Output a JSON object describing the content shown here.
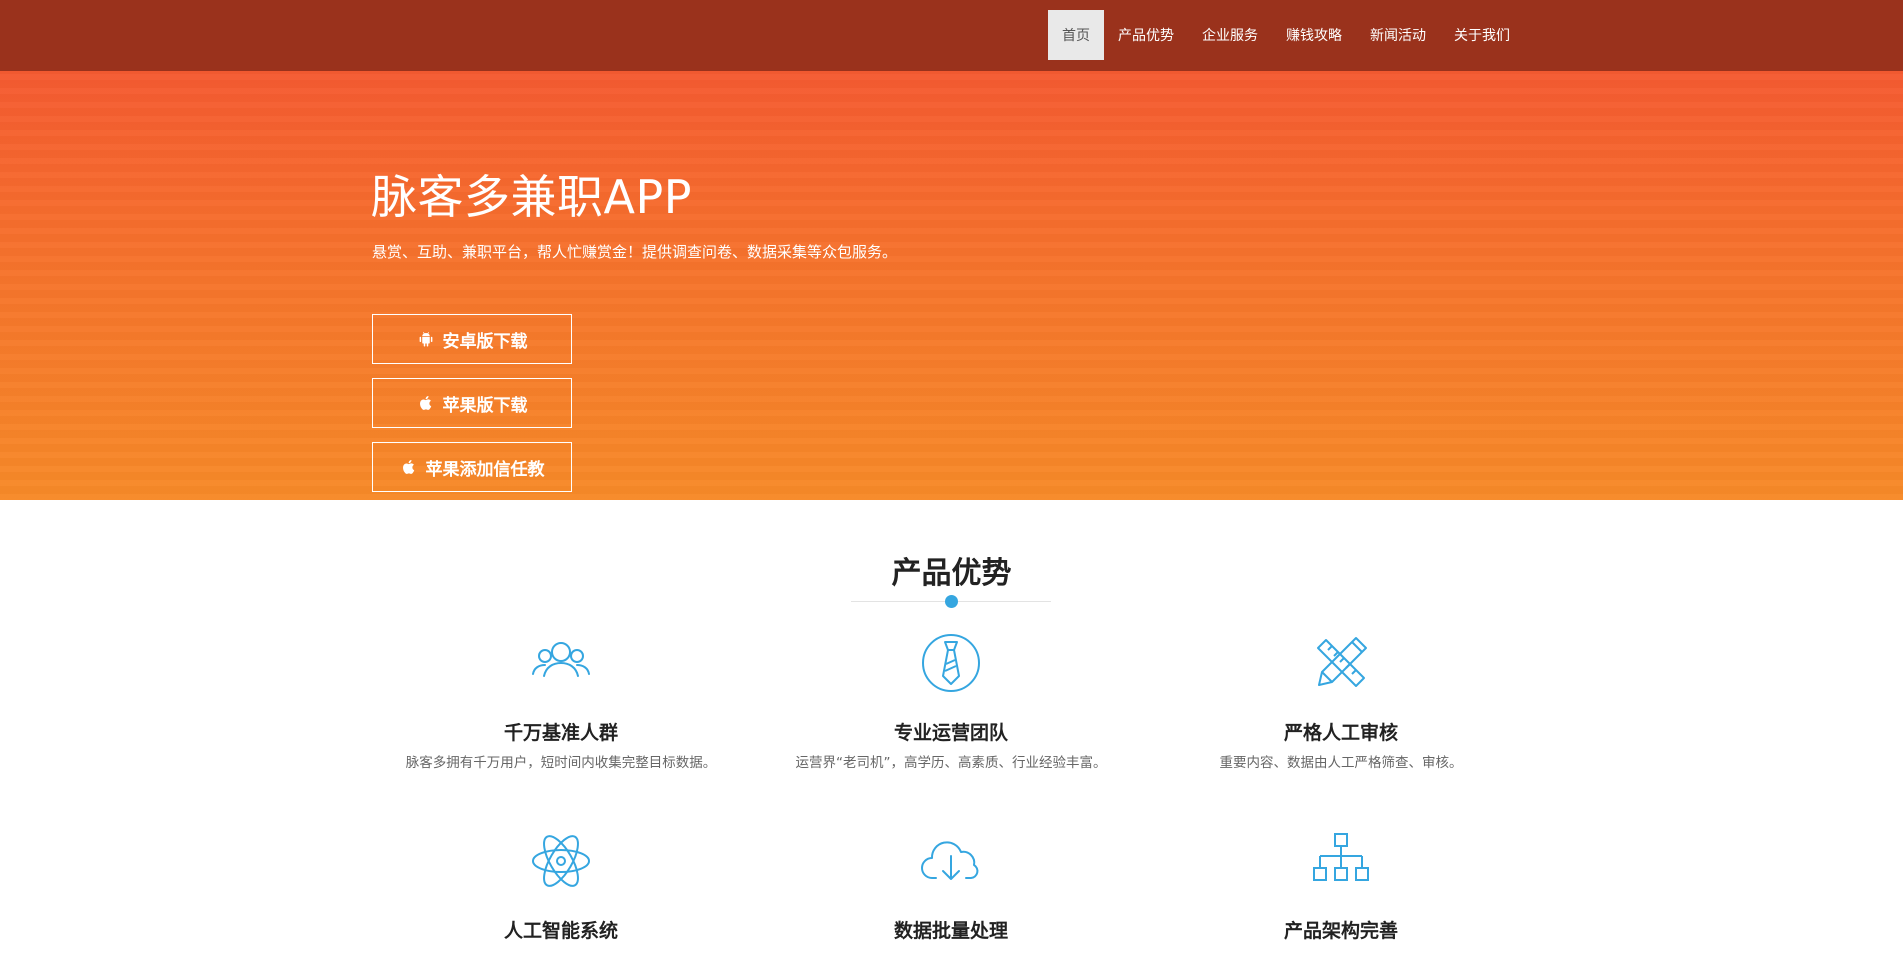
{
  "nav": {
    "items": [
      {
        "label": "首页",
        "active": true
      },
      {
        "label": "产品优势",
        "active": false
      },
      {
        "label": "企业服务",
        "active": false
      },
      {
        "label": "赚钱攻略",
        "active": false
      },
      {
        "label": "新闻活动",
        "active": false
      },
      {
        "label": "关于我们",
        "active": false
      }
    ]
  },
  "hero": {
    "title": "脉客多兼职APP",
    "subtitle": "悬赏、互助、兼职平台，帮人忙赚赏金！提供调查问卷、数据采集等众包服务。",
    "buttons": [
      {
        "label": "安卓版下载",
        "icon": "android-icon"
      },
      {
        "label": "苹果版下载",
        "icon": "apple-icon"
      },
      {
        "label": "苹果添加信任教",
        "icon": "apple-icon"
      }
    ]
  },
  "features": {
    "title": "产品优势",
    "items": [
      {
        "title": "千万基准人群",
        "desc": "脉客多拥有千万用户，短时间内收集完整目标数据。",
        "icon": "users-icon"
      },
      {
        "title": "专业运营团队",
        "desc": "运营界“老司机”，高学历、高素质、行业经验丰富。",
        "icon": "tie-icon"
      },
      {
        "title": "严格人工审核",
        "desc": "重要内容、数据由人工严格筛查、审核。",
        "icon": "ruler-pencil-icon"
      },
      {
        "title": "人工智能系统",
        "desc": "",
        "icon": "atom-icon"
      },
      {
        "title": "数据批量处理",
        "desc": "",
        "icon": "cloud-download-icon"
      },
      {
        "title": "产品架构完善",
        "desc": "",
        "icon": "hierarchy-icon"
      }
    ]
  },
  "colors": {
    "topbar": "#9a321c",
    "hero_top": "#f55a31",
    "hero_bottom": "#f78a28",
    "accent_blue": "#35a6e0"
  }
}
